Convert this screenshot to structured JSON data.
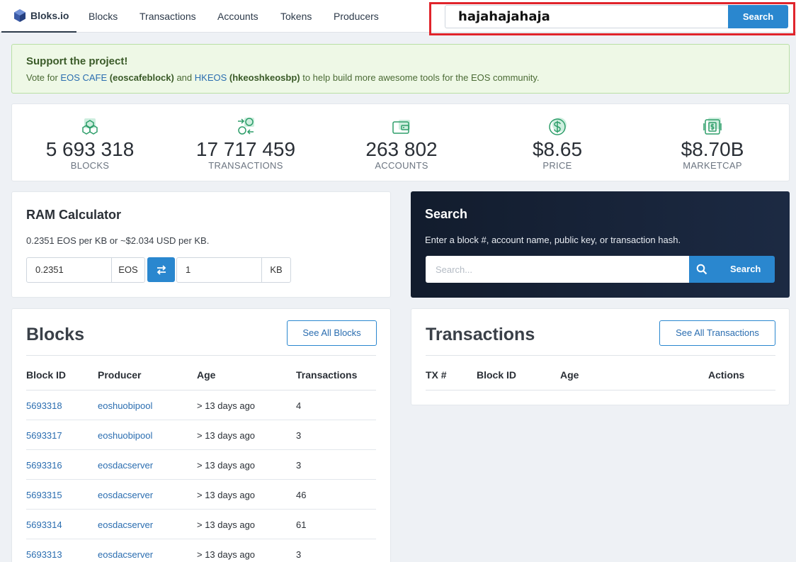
{
  "nav": {
    "brand": "Bloks.io",
    "links": [
      "Blocks",
      "Transactions",
      "Accounts",
      "Tokens",
      "Producers"
    ],
    "search_value": "hajahajahaja",
    "search_button": "Search"
  },
  "alert": {
    "title": "Support the project!",
    "text_prefix": "Vote for ",
    "link1": "EOS CAFE",
    "link1_account": "(eoscafeblock)",
    "text_and": " and ",
    "link2": "HKEOS",
    "link2_account": "(hkeoshkeosbp)",
    "text_suffix": " to help build more awesome tools for the EOS community."
  },
  "stats": [
    {
      "value": "5 693 318",
      "label": "BLOCKS",
      "icon": "blocks-icon"
    },
    {
      "value": "17 717 459",
      "label": "TRANSACTIONS",
      "icon": "exchange-icon"
    },
    {
      "value": "263 802",
      "label": "ACCOUNTS",
      "icon": "wallet-icon"
    },
    {
      "value": "$8.65",
      "label": "PRICE",
      "icon": "dollar-icon"
    },
    {
      "value": "$8.70B",
      "label": "MARKETCAP",
      "icon": "marketcap-icon"
    }
  ],
  "ram": {
    "title": "RAM Calculator",
    "rate": "0.2351 EOS per KB or ~$2.034 USD per KB.",
    "eos_value": "0.2351",
    "eos_unit": "EOS",
    "kb_value": "1",
    "kb_unit": "KB"
  },
  "search": {
    "title": "Search",
    "subtitle": "Enter a block #, account name, public key, or transaction hash.",
    "placeholder": "Search...",
    "button": "Search"
  },
  "blocks": {
    "title": "Blocks",
    "see_all": "See All Blocks",
    "headers": [
      "Block ID",
      "Producer",
      "Age",
      "Transactions"
    ],
    "rows": [
      {
        "id": "5693318",
        "producer": "eoshuobipool",
        "age": "> 13 days ago",
        "tx": "4"
      },
      {
        "id": "5693317",
        "producer": "eoshuobipool",
        "age": "> 13 days ago",
        "tx": "3"
      },
      {
        "id": "5693316",
        "producer": "eosdacserver",
        "age": "> 13 days ago",
        "tx": "3"
      },
      {
        "id": "5693315",
        "producer": "eosdacserver",
        "age": "> 13 days ago",
        "tx": "46"
      },
      {
        "id": "5693314",
        "producer": "eosdacserver",
        "age": "> 13 days ago",
        "tx": "61"
      },
      {
        "id": "5693313",
        "producer": "eosdacserver",
        "age": "> 13 days ago",
        "tx": "3"
      }
    ]
  },
  "transactions": {
    "title": "Transactions",
    "see_all": "See All Transactions",
    "headers": [
      "TX #",
      "Block ID",
      "Age",
      "Actions"
    ]
  },
  "colors": {
    "accent": "#2a87cf",
    "link": "#2a6db0",
    "highlight": "#e0242b",
    "icon_green": "#2e9e6a"
  }
}
